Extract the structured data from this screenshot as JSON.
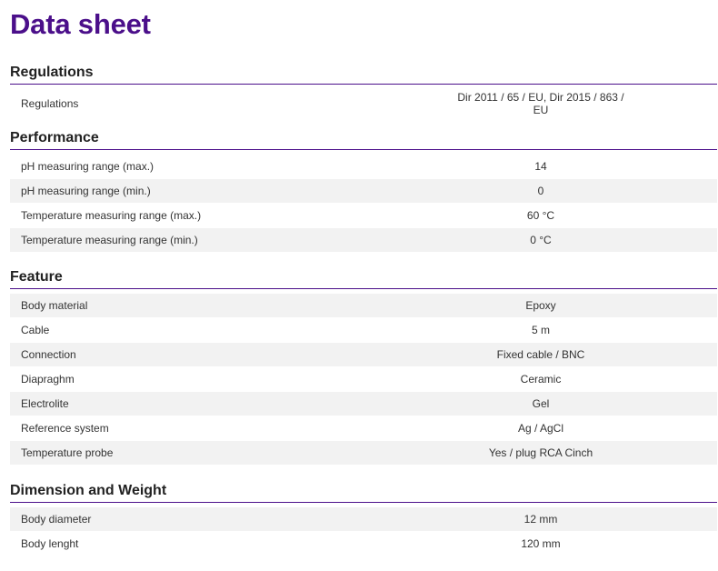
{
  "title": "Data sheet",
  "sections": [
    {
      "title": "Regulations",
      "rows": [
        {
          "label": "Regulations",
          "value": "Dir 2011 / 65 / EU, Dir 2015 / 863 / EU"
        }
      ]
    },
    {
      "title": "Performance",
      "rows": [
        {
          "label": "pH measuring range (max.)",
          "value": "14"
        },
        {
          "label": "pH measuring range (min.)",
          "value": "0"
        },
        {
          "label": "Temperature measuring range (max.)",
          "value": "60 °C"
        },
        {
          "label": "Temperature measuring range (min.)",
          "value": "0 °C"
        }
      ]
    },
    {
      "title": "Feature",
      "rows": [
        {
          "label": "Body material",
          "value": "Epoxy"
        },
        {
          "label": "Cable",
          "value": "5 m"
        },
        {
          "label": "Connection",
          "value": "Fixed cable / BNC"
        },
        {
          "label": "Diapraghm",
          "value": "Ceramic"
        },
        {
          "label": "Electrolite",
          "value": "Gel"
        },
        {
          "label": "Reference system",
          "value": "Ag / AgCl"
        },
        {
          "label": "Temperature probe",
          "value": "Yes / plug RCA Cinch"
        }
      ]
    },
    {
      "title": "Dimension and Weight",
      "rows": [
        {
          "label": "Body diameter",
          "value": "12 mm"
        },
        {
          "label": "Body lenght",
          "value": "120 mm"
        }
      ]
    }
  ]
}
